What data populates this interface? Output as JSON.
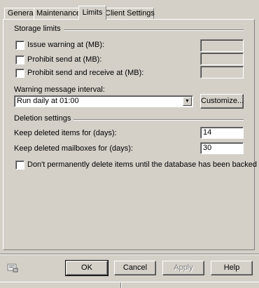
{
  "tabs": [
    {
      "label": "General"
    },
    {
      "label": "Maintenance"
    },
    {
      "label": "Limits"
    },
    {
      "label": "Client Settings"
    }
  ],
  "storage": {
    "title": "Storage limits",
    "issue_warning_label": "Issue warning at (MB):",
    "prohibit_send_label": "Prohibit send at (MB):",
    "prohibit_send_receive_label": "Prohibit send and receive at (MB):",
    "issue_warning_value": "",
    "prohibit_send_value": "",
    "prohibit_send_receive_value": "",
    "warning_interval_label": "Warning message interval:",
    "warning_interval_value": "Run daily at 01:00",
    "customize_label": "Customize..."
  },
  "deletion": {
    "title": "Deletion settings",
    "keep_items_label": "Keep deleted items for (days):",
    "keep_items_value": "14",
    "keep_mailboxes_label": "Keep deleted mailboxes for (days):",
    "keep_mailboxes_value": "30",
    "backup_label": "Don't permanently delete items until the database has been backed up."
  },
  "buttons": {
    "ok": "OK",
    "cancel": "Cancel",
    "apply": "Apply",
    "help": "Help"
  },
  "icons": {
    "bottom_left": "properties-icon",
    "dropdown": "chevron-down-icon"
  }
}
